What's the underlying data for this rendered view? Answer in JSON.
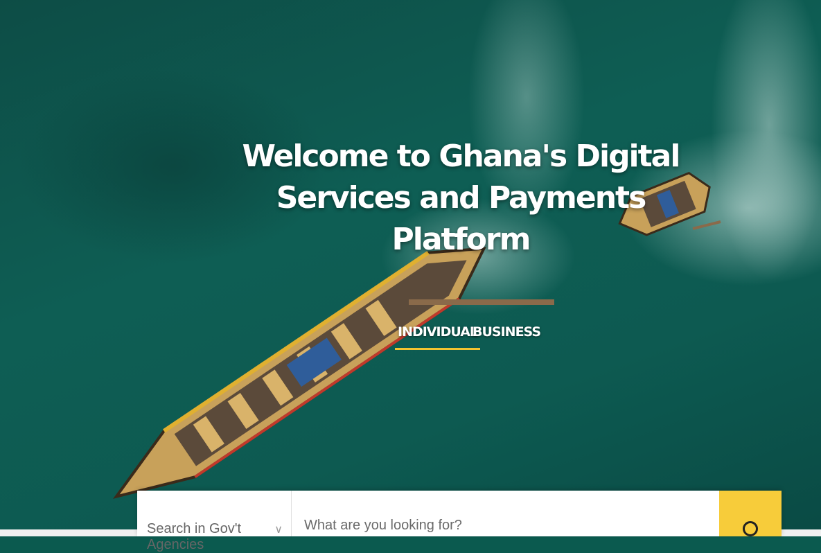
{
  "hero": {
    "title": "Welcome to Ghana's Digital Services and Payments Platform"
  },
  "tabs": [
    {
      "label": "INDIVIDUAL",
      "active": true
    },
    {
      "label": "BUSINESS",
      "active": false
    }
  ],
  "search": {
    "agency_select_label": "Search in Gov't Agencies",
    "input_placeholder": "What are you looking for?",
    "button_icon": "search-icon"
  },
  "colors": {
    "accent": "#f7cc3a",
    "hero_water": "#0d5a51"
  }
}
